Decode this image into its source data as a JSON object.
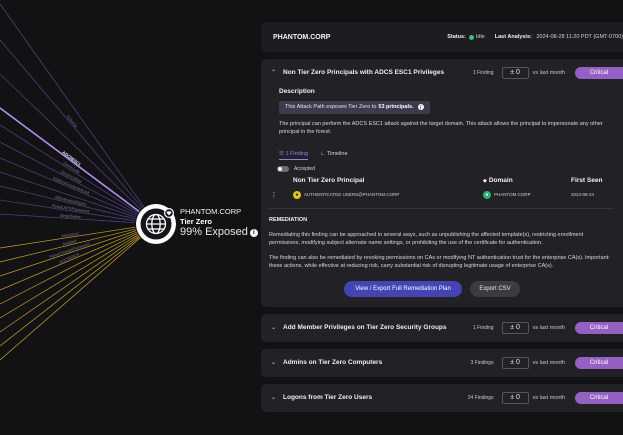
{
  "node": {
    "name": "PHANTOM.CORP",
    "tier": "Tier Zero",
    "exposed": "99% Exposed"
  },
  "edge_labels": [
    {
      "text": "Schema",
      "highlight": false
    },
    {
      "text": "ADCSESC1",
      "highlight": true
    },
    {
      "text": "GenericAll",
      "highlight": false
    },
    {
      "text": "GenericWrite",
      "highlight": false
    },
    {
      "text": "AddKeyCredentialLink",
      "highlight": false
    },
    {
      "text": "AllExtendedRights",
      "highlight": false
    },
    {
      "text": "ReadLAPSPassword",
      "highlight": false
    },
    {
      "text": "WriteOwner",
      "highlight": false
    },
    {
      "text": "WriteDacl",
      "highlight": false
    },
    {
      "text": "AddSelf",
      "highlight": false
    },
    {
      "text": "ForceChangePassword",
      "highlight": false
    },
    {
      "text": "ADCSESC6",
      "highlight": false
    }
  ],
  "header": {
    "org": "PHANTOM.CORP",
    "status_label": "Status:",
    "status_value": "Idle",
    "analysis_label": "Last Analysis:",
    "analysis_value": "2024-08-28 11:20 PDT (GMT-0700)"
  },
  "vs_text": "vs last month",
  "expanded": {
    "title": "Non Tier Zero Principals with ADCS ESC1 Privileges",
    "count": "1 Finding",
    "delta": "± 0",
    "severity": "Critical",
    "description_heading": "Description",
    "exposure_prefix": "This Attack Path exposes Tier Zero to",
    "exposure_value": "53 principals.",
    "description": "The principal can perform the ADCS ESC1 attack against the target domain. This attack allows the principal to impersonate any other principal in the forest.",
    "tabs": [
      "1 Finding",
      "Timeline"
    ],
    "accepted_label": "Accepted",
    "columns": [
      "Non Tier Zero Principal",
      "Domain",
      "First Seen"
    ],
    "row": {
      "principal": "AUTHENTICATED USERS@PHANTOM.CORP",
      "domain": "PHANTOM.CORP",
      "first_seen": "2024-08-24"
    },
    "remediation_heading": "REMEDIATION",
    "remediation_1": "Remediating this finding can be approached in several ways, such as unpublishing the affected template(s), restricting enrollment permissions, modifying subject alternate name settings, or prohibiting the use of the certificate for authentication.",
    "remediation_2": "The finding can also be remediated by revoking permissions on CAs or modifying NT authentication trust for the enterprise CA(s). Important: these actions, while effective at reducing risk, carry substantial risk of disrupting legitimate usage of enterprise CA(s).",
    "primary_button": "View / Export Full Remediation Plan",
    "secondary_button": "Export CSV"
  },
  "collapsed": [
    {
      "title": "Add Member Privileges on Tier Zero Security Groups",
      "count": "1 Finding",
      "delta": "± 0",
      "severity": "Critical"
    },
    {
      "title": "Admins on Tier Zero Computers",
      "count": "3 Findings",
      "delta": "± 0",
      "severity": "Critical"
    },
    {
      "title": "Logons from Tier Zero Users",
      "count": "24 Findings",
      "delta": "± 0",
      "severity": "Critical"
    }
  ],
  "colors": {
    "accent_purple": "#9461c2",
    "highlight_edge": "#b58cf0",
    "gold_edge": "#c9a227",
    "status_green": "#35c27a",
    "button_blue": "#4444b4"
  },
  "icons": {
    "node": "globe-icon",
    "badge": "heart-shield-icon",
    "chevron_expanded": "chevron-up-icon",
    "chevron_collapsed": "chevron-down-icon",
    "principal": "user-group-icon",
    "domain": "globe-icon",
    "row_menu": "kebab-icon"
  }
}
